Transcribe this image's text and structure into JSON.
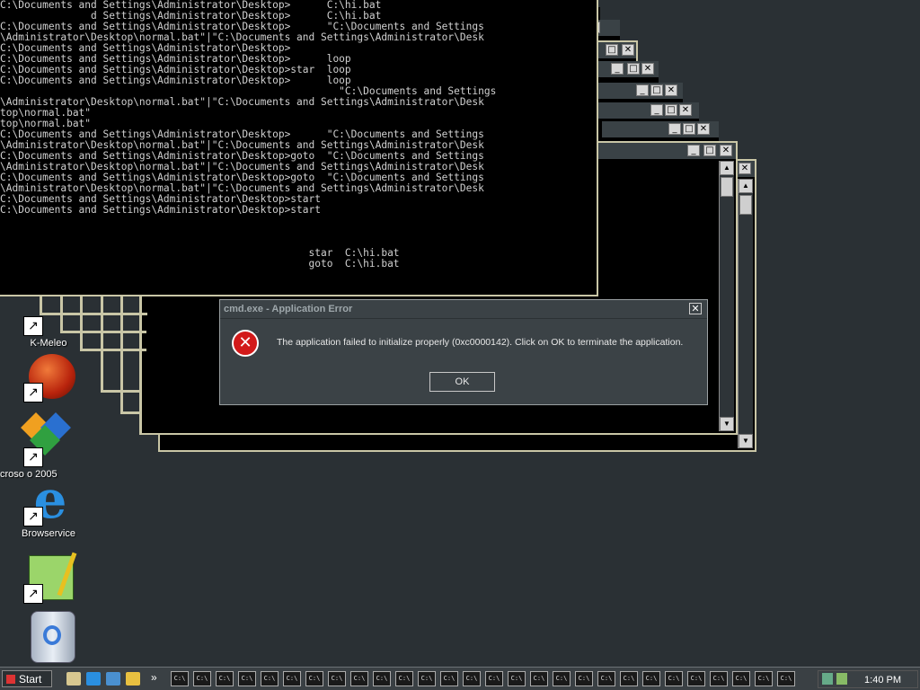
{
  "console": {
    "lines": [
      "C:\\Documents and Settings\\Administrator\\Desktop>      C:\\hi.bat",
      "               d Settings\\Administrator\\Desktop>      C:\\hi.bat",
      "C:\\Documents and Settings\\Administrator\\Desktop>      \"C:\\Documents and Settings",
      "\\Administrator\\Desktop\\normal.bat\"|\"C:\\Documents and Settings\\Administrator\\Desk",
      "C:\\Documents and Settings\\Administrator\\Desktop>",
      "C:\\Documents and Settings\\Administrator\\Desktop>      loop",
      "C:\\Documents and Settings\\Administrator\\Desktop>star  loop",
      "C:\\Documents and Settings\\Administrator\\Desktop>      loop",
      "                                                        \"C:\\Documents and Settings",
      "\\Administrator\\Desktop\\normal.bat\"|\"C:\\Documents and Settings\\Administrator\\Desk",
      "top\\normal.bat\"",
      "top\\normal.bat\"",
      "C:\\Documents and Settings\\Administrator\\Desktop>      \"C:\\Documents and Settings",
      "\\Administrator\\Desktop\\normal.bat\"|\"C:\\Documents and Settings\\Administrator\\Desk",
      "C:\\Documents and Settings\\Administrator\\Desktop>goto  \"C:\\Documents and Settings",
      "\\Administrator\\Desktop\\normal.bat\"|\"C:\\Documents and Settings\\Administrator\\Desk",
      "C:\\Documents and Settings\\Administrator\\Desktop>goto  \"C:\\Documents and Settings",
      "\\Administrator\\Desktop\\normal.bat\"|\"C:\\Documents and Settings\\Administrator\\Desk",
      "C:\\Documents and Settings\\Administrator\\Desktop>start",
      "C:\\Documents and Settings\\Administrator\\Desktop>start",
      "",
      "",
      "",
      "                                                   star  C:\\hi.bat",
      "                                                   goto  C:\\hi.bat"
    ]
  },
  "desktop_icons": [
    {
      "label": "K-Meleo",
      "icon": "k-meleo-icon"
    },
    {
      "label": "",
      "icon": "red-ball-icon"
    },
    {
      "label": "croso            o 2005",
      "icon": "visual-studio-icon"
    },
    {
      "label": "Browservice",
      "icon": "internet-explorer-icon"
    },
    {
      "label": "",
      "icon": "paint-frog-icon"
    },
    {
      "label": "",
      "icon": "recycle-bin-icon"
    }
  ],
  "dialog": {
    "title": "cmd.exe - Application Error",
    "message": "The application failed to initialize properly (0xc0000142). Click on OK to terminate the application.",
    "ok_label": "OK",
    "close_glyph": "✕",
    "error_glyph": "✕"
  },
  "taskbar": {
    "start_label": "Start",
    "task_label": "C:\\",
    "chevron": "»",
    "clock": "1:40 PM"
  },
  "colors": {
    "desktop": "#2a3034",
    "console_bg": "#000000",
    "console_text": "#d0d0d0",
    "window_frame": "#c9c6a6",
    "dialog_bg": "#3b4246",
    "error_red": "#d21a1a"
  }
}
